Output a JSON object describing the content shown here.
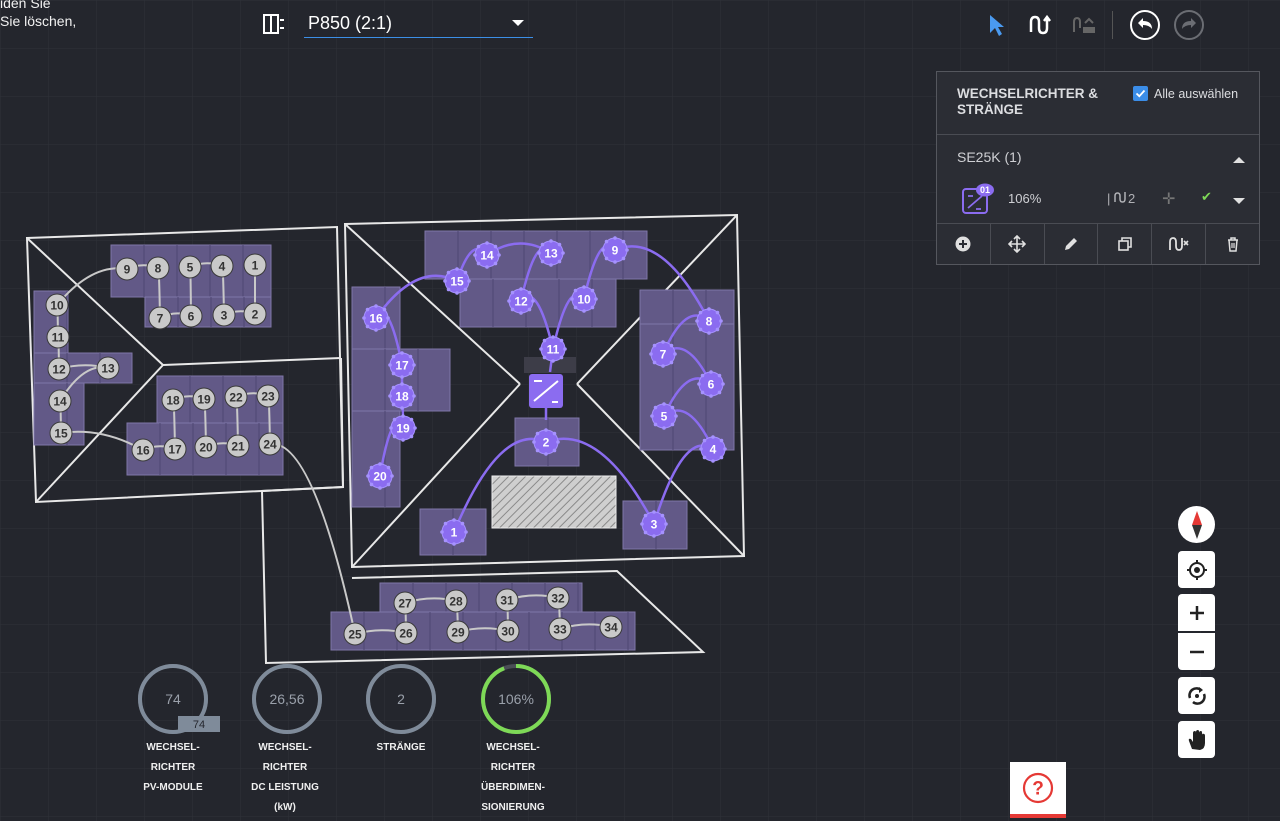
{
  "hint": {
    "line1": "iden Sie",
    "line2": "Sie löschen,"
  },
  "design": {
    "name": "P850 (2:1)"
  },
  "toolbar": {
    "tools": [
      "select-pointer-icon",
      "string-wiring-icon",
      "auto-string-icon",
      "undo-icon",
      "redo-icon"
    ]
  },
  "panel": {
    "title": "WECHSELRICHTER & STRÄNGE",
    "select_all": "Alle auswählen",
    "inverter": {
      "name": "SE25K (1)",
      "badge": "01",
      "dc_ac_ratio": "106%",
      "strings_label": "2",
      "check": "✔"
    }
  },
  "gauges": [
    {
      "value": "74",
      "sub": "74",
      "label": "WECHSEL-\nRICHTER\nPV-MODULE",
      "fill": 1.0,
      "color": "#7f8b9a"
    },
    {
      "value": "26,56",
      "label": "WECHSEL-\nRICHTER\nDC LEISTUNG\n(kW)",
      "fill": 1.0,
      "color": "#7f8b9a"
    },
    {
      "value": "2",
      "label": "STRÄNGE",
      "fill": 1.0,
      "color": "#7f8b9a"
    },
    {
      "value": "106%",
      "label": "WECHSEL-\nRICHTER\nÜBERDIMEN-\nSIONIERUNG",
      "fill": 0.94,
      "color": "#7ed957"
    }
  ],
  "map_controls": [
    "compass-icon",
    "locate-icon",
    "zoom-in-icon",
    "zoom-out-icon",
    "rotate-icon",
    "pan-hand-icon"
  ],
  "help": {
    "label": "?"
  },
  "modules": {
    "grey": [
      "1",
      "2",
      "3",
      "4",
      "5",
      "6",
      "7",
      "8",
      "9",
      "10",
      "11",
      "12",
      "13",
      "14",
      "15",
      "16",
      "17",
      "18",
      "19",
      "20",
      "21",
      "22",
      "23",
      "24",
      "25",
      "26",
      "27",
      "28",
      "29",
      "30",
      "31",
      "32",
      "33",
      "34"
    ],
    "purple_string1": [
      "1",
      "2",
      "3",
      "4",
      "5",
      "6",
      "7",
      "8",
      "9",
      "10",
      "11",
      "12",
      "13",
      "14",
      "15",
      "16",
      "17",
      "18",
      "19",
      "20"
    ]
  },
  "colors": {
    "accent": "#3b8de8",
    "string": "#8b6cf0",
    "module": "#625987",
    "grey_node": "#c9c9c9",
    "ok": "#7ed957",
    "help_border": "#e53935"
  }
}
